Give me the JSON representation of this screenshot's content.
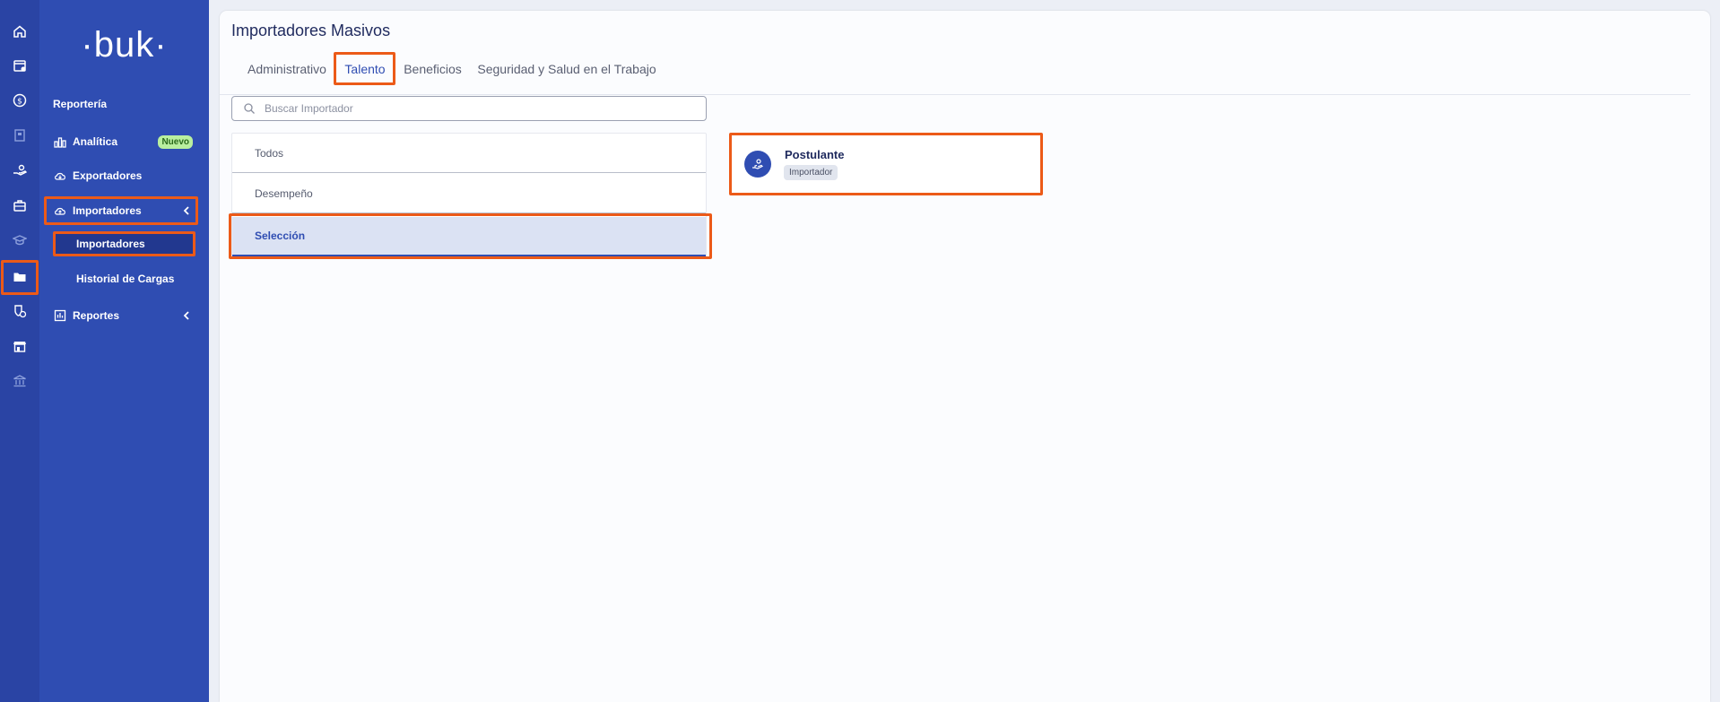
{
  "brand": {
    "logo_text": "·buk·"
  },
  "rail": {
    "icons": [
      "home-icon",
      "calendar-icon",
      "dollar-icon",
      "building-icon",
      "hand-money-icon",
      "briefcase-icon",
      "graduation-icon",
      "folder-icon",
      "shield-clock-icon",
      "store-icon",
      "bank-icon"
    ],
    "active": "folder-icon"
  },
  "sidebar": {
    "section_title": "Reportería",
    "items": [
      {
        "label": "Analítica",
        "badge": "Nuevo",
        "icon": "chart-icon"
      },
      {
        "label": "Exportadores",
        "icon": "cloud-download-icon"
      },
      {
        "label": "Importadores",
        "icon": "cloud-upload-icon",
        "expanded": true
      },
      {
        "label": "Reportes",
        "icon": "report-icon"
      }
    ],
    "sub_items": [
      {
        "label": "Importadores",
        "active": true
      },
      {
        "label": "Historial de Cargas"
      }
    ]
  },
  "main": {
    "title": "Importadores Masivos",
    "tabs": [
      {
        "label": "Administrativo"
      },
      {
        "label": "Talento",
        "active": true
      },
      {
        "label": "Beneficios"
      },
      {
        "label": "Seguridad y Salud en el Trabajo"
      }
    ],
    "search": {
      "placeholder": "Buscar Importador",
      "value": ""
    },
    "categories": [
      {
        "label": "Todos"
      },
      {
        "label": "Desempeño"
      },
      {
        "label": "Selección",
        "active": true
      }
    ],
    "cards": [
      {
        "title": "Postulante",
        "tag": "Importador",
        "icon": "hand-user-icon"
      }
    ]
  },
  "colors": {
    "rail": "#2a44a4",
    "sidebar": "#2f4db2",
    "accent": "#2f4db2",
    "highlight": "#ec5a18",
    "badge": "#b9ef9f"
  }
}
